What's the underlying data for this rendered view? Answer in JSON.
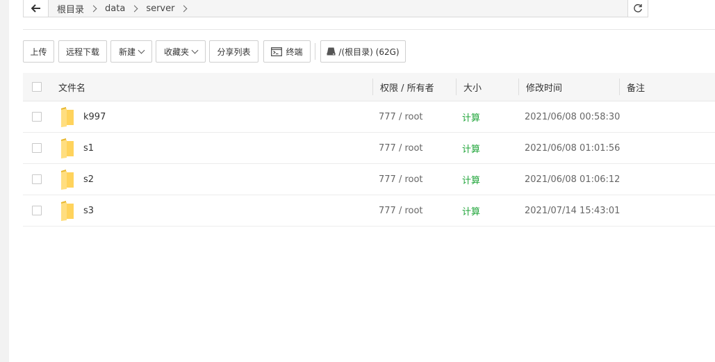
{
  "breadcrumb": {
    "items": [
      "根目录",
      "data",
      "server"
    ]
  },
  "toolbar": {
    "upload": "上传",
    "remote_download": "远程下载",
    "new": "新建",
    "favorites": "收藏夹",
    "share_list": "分享列表",
    "terminal": "终端",
    "disk": "/(根目录) (62G)"
  },
  "table": {
    "headers": {
      "name": "文件名",
      "perm": "权限 / 所有者",
      "size": "大小",
      "mtime": "修改时间",
      "note": "备注"
    },
    "rows": [
      {
        "name": "k997",
        "perm": "777 / root",
        "size": "计算",
        "mtime": "2021/06/08 00:58:30"
      },
      {
        "name": "s1",
        "perm": "777 / root",
        "size": "计算",
        "mtime": "2021/06/08 01:01:56"
      },
      {
        "name": "s2",
        "perm": "777 / root",
        "size": "计算",
        "mtime": "2021/06/08 01:06:12"
      },
      {
        "name": "s3",
        "perm": "777 / root",
        "size": "计算",
        "mtime": "2021/07/14 15:43:01"
      }
    ]
  },
  "colors": {
    "size_link": "#20a53a",
    "folder": "#ffd35c"
  },
  "icons": [
    "arrow-left-icon",
    "refresh-icon",
    "terminal-icon",
    "disk-icon",
    "folder-icon",
    "chevron-right-icon",
    "chevron-down-icon"
  ]
}
